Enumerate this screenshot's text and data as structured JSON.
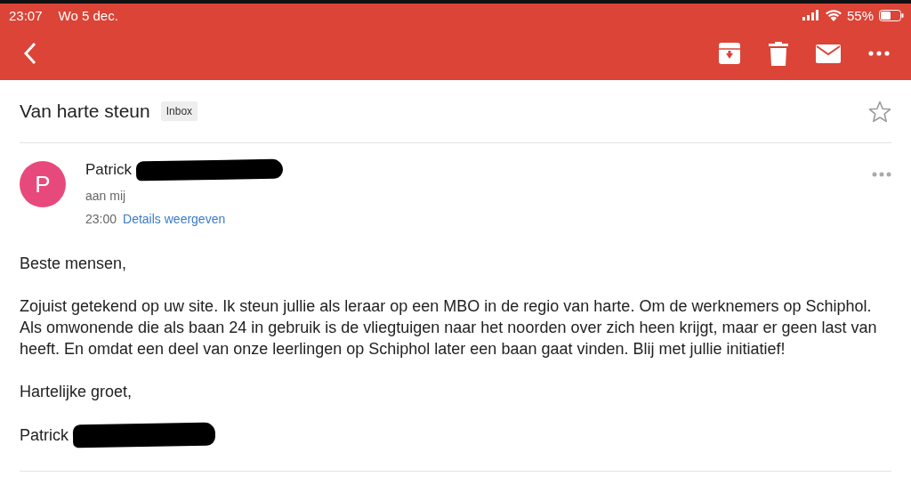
{
  "status_bar": {
    "time": "23:07",
    "date": "Wo 5 dec.",
    "battery": "55%"
  },
  "subject": {
    "title": "Van harte steun",
    "label": "Inbox",
    "starred": false
  },
  "message": {
    "sender": "Patrick",
    "avatar_letter": "P",
    "recipient": "aan mij",
    "time": "23:00",
    "details_link": "Details weergeven",
    "body": [
      "Beste mensen,",
      "Zojuist getekend op uw site. Ik steun jullie als leraar op een MBO in de regio van harte. Om de werknemers op Schiphol. Als omwonende die als baan 24 in gebruik is de vliegtuigen naar het noorden over zich heen krijgt, maar er geen last van heeft. En omdat een deel van onze leerlingen op Schiphol later een baan gaat vinden. Blij met jullie initiatief!",
      "Hartelijke groet,"
    ],
    "signature": "Patrick"
  }
}
